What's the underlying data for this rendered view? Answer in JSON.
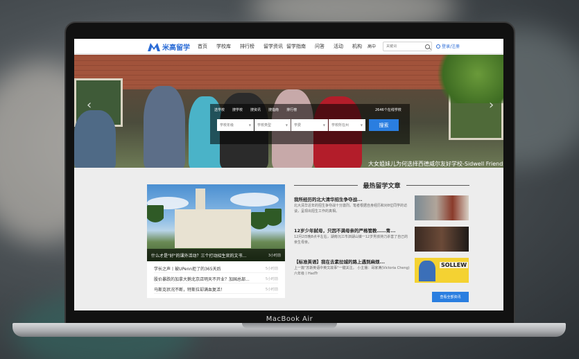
{
  "device": {
    "label": "MacBook Air"
  },
  "nav": {
    "logo_text": "米高留学",
    "items": [
      "首页",
      "学校库",
      "排行榜",
      "留学资讯",
      "留学指南",
      "问答",
      "活动",
      "机构"
    ],
    "region": "高中",
    "search_placeholder": "关键词",
    "login": "登录/注册"
  },
  "hero": {
    "tabs": [
      "选学校",
      "搜学校",
      "搜资讯",
      "搜指南",
      "排行榜"
    ],
    "count_text": "2646个在线学校",
    "selects": [
      "学校年级",
      "学校类型",
      "学费",
      "学校所在州"
    ],
    "search_button": "搜索",
    "caption": "大女姐妹儿为何选择西德威尔友好学校-Sidwell Friends"
  },
  "featured": {
    "caption": "什么才是\"好\"的课外活动？三个打动招生官的文书...",
    "caption_time": "3小时前",
    "news": [
      {
        "title": "学长之声丨被UPenn拒了的365天后",
        "time": "5小时前"
      },
      {
        "title": "股价暴跌的加拿大鹅北京店明天不开业？加国总部...",
        "time": "5小时前"
      },
      {
        "title": "马斯克状况不断，特斯拉却满血复活！",
        "time": "5小时前"
      }
    ]
  },
  "hot": {
    "section_title": "最热留学文章",
    "articles": [
      {
        "title": "我所经历的北大清华招生争夺战...",
        "desc": "北大清华近年的招生争夺战十分激烈。笔者根据自身经历和对8位同学的访谈，呈现出招生工作的真相。"
      },
      {
        "title": "12岁少年弑母，只因不满母亲的严格管教……青...",
        "desc": "12月2日晚8点半左右，湖南沅江市泗湖山镇一12岁男孩持刀杀害了自己的亲生母亲。"
      },
      {
        "title": "【标准英语】我在去素拉城的路上遇到麻烦...",
        "desc": "上一篇\"苏斯英语中英文故事\"一键关注。 小主播：哥家满(Victoria Cheng) 六年级丨HadTr"
      }
    ],
    "thumb3_text": "SOLLEW",
    "more_button": "查看全部资讯"
  }
}
